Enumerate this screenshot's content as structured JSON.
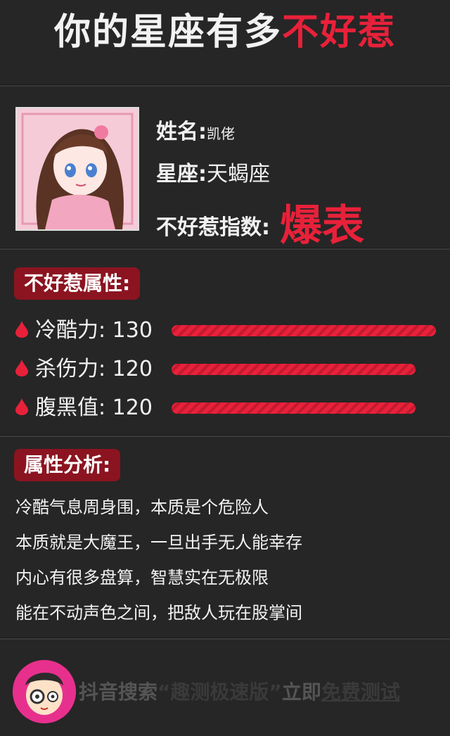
{
  "title": {
    "main": "你的星座有多",
    "highlight": "不好惹"
  },
  "profile": {
    "name_label": "姓名:",
    "name_value": "凯佬",
    "sign_label": "星座:",
    "sign_value": "天蝎座",
    "index_label": "不好惹指数:",
    "index_value": "爆表"
  },
  "attributes": {
    "heading": "不好惹属性:",
    "items": [
      {
        "label": "冷酷力: 130",
        "level": 130
      },
      {
        "label": "杀伤力: 120",
        "level": 120
      },
      {
        "label": "腹黑值: 120",
        "level": 120
      }
    ],
    "max_level": 130
  },
  "analysis": {
    "heading": "属性分析:",
    "lines": [
      "冷酷气息周身围，本质是个危险人",
      "本质就是大魔王，一旦出手无人能幸存",
      "内心有很多盘算，智慧实在无极限",
      "能在不动声色之间，把敌人玩在股掌间"
    ]
  },
  "footer": {
    "prefix": "抖音搜索",
    "app_name": "“趣测极速版”",
    "middle": "立即",
    "cta": "免费测试"
  },
  "colors": {
    "accent": "#e8213a",
    "tag_bg": "#8b1420",
    "background": "#262626"
  }
}
